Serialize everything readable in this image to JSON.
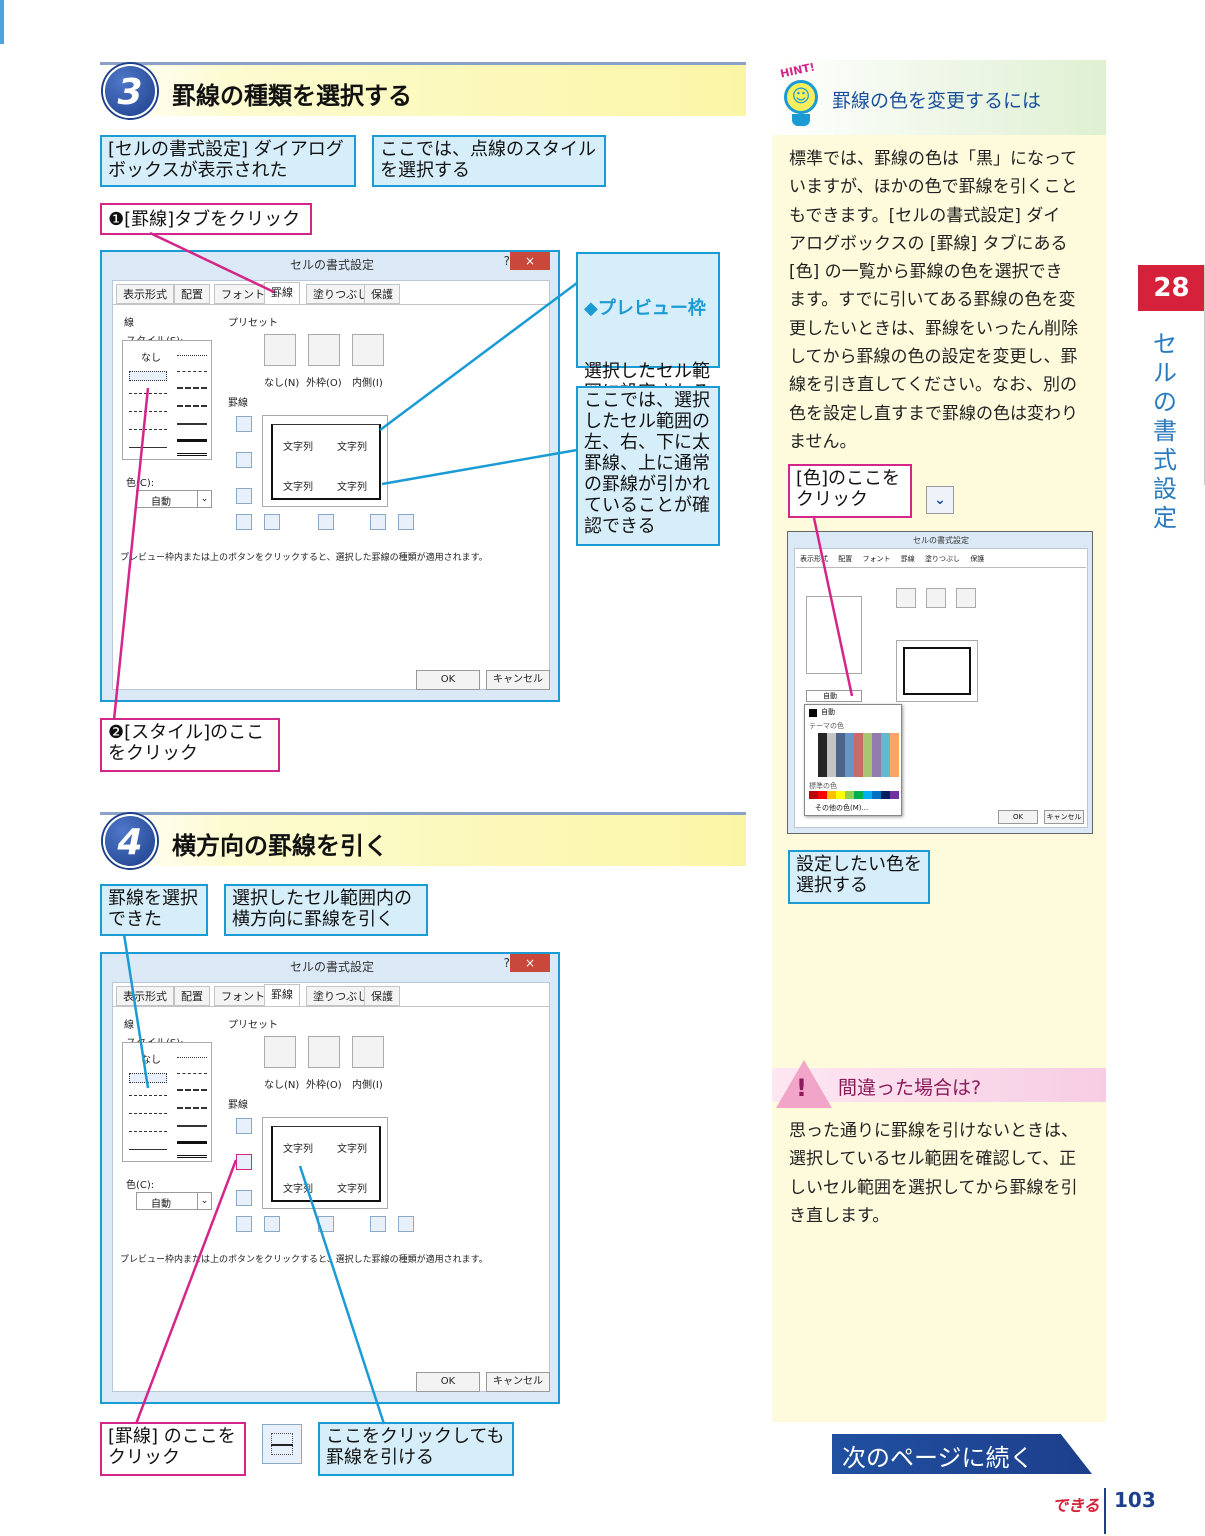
{
  "step3": {
    "number": "3",
    "title": "罫線の種類を選択する",
    "callout_dialog_shown": "[セルの書式設定] ダイアログ\nボックスが表示された",
    "callout_dotted": "ここでは、点線のスタイル\nを選択する",
    "callout_tab": "❶[罫線]タブをクリック",
    "callout_preview_title": "◆プレビュー枠",
    "callout_preview_body": "選択したセル範\n囲に設定される\n罫線の状態が表\n示される",
    "callout_here": "ここでは、選択\nしたセル範囲の\n左、右、下に太\n罫線、上に通常\nの罫線が引かれ\nていることが確\n認できる",
    "callout_style": "❷[スタイル]のここ\nをクリック"
  },
  "step4": {
    "number": "4",
    "title": "横方向の罫線を引く",
    "callout_selected": "罫線を選択\nできた",
    "callout_horizontal": "選択したセル範囲内の\n横方向に罫線を引く",
    "callout_border_btn": "[罫線] のここを\nクリック",
    "callout_click_here": "ここをクリックしても\n罫線を引ける"
  },
  "dialog": {
    "title": "セルの書式設定",
    "help": "?",
    "close": "×",
    "tabs": [
      "表示形式",
      "配置",
      "フォント",
      "罫線",
      "塗りつぶし",
      "保護"
    ],
    "line_group": "線",
    "style_label": "スタイル(S):",
    "none_label": "なし",
    "color_label": "色(C):",
    "color_value": "自動",
    "preset_label": "プリセット",
    "preset_none": "なし(N)",
    "preset_outline": "外枠(O)",
    "preset_inside": "内側(I)",
    "border_label": "罫線",
    "cell_text": "文字列",
    "hint": "プレビュー枠内または上のボタンをクリックすると、選択した罫線の種類が適用されます。",
    "ok": "OK",
    "cancel": "キャンセル"
  },
  "sidebar": {
    "hint_badge": "HINT!",
    "hint_title": "罫線の色を変更するには",
    "hint_body": "標準では、罫線の色は「黒」になって\nいますが、ほかの色で罫線を引くこと\nもできます。[セルの書式設定] ダイ\nアログボックスの [罫線] タブにある\n[色] の一覧から罫線の色を選択でき\nます。すでに引いてある罫線の色を変\n更したいときは、罫線をいったん削除\nしてから罫線の色の設定を変更し、罫\n線を引き直してください。なお、別の\n色を設定し直すまで罫線の色は変わり\nません。",
    "callout_color": "[色]のここを\nクリック",
    "callout_pick": "設定したい色を\n選択する",
    "mini_auto": "自動",
    "mini_theme": "テーマの色",
    "mini_standard": "標準の色",
    "mini_other": "その他の色(M)...",
    "warn_title": "間違った場合は?",
    "warn_body": "思った通りに罫線を引けないときは、\n選択しているセル範囲を確認して、正\nしいセル範囲を選択してから罫線を引\nき直します。",
    "next": "次のページに続く"
  },
  "chapter": {
    "number": "28",
    "title": "セルの書式設定"
  },
  "footer": {
    "brand": "できる",
    "page": "103"
  },
  "colors": {
    "blue_callout": "#1a9bd4",
    "pink_callout": "#d4258a",
    "chapter_red": "#d6213b",
    "step_circle": "#1d3f8c",
    "sidebar_bg": "#fdfbdc"
  }
}
